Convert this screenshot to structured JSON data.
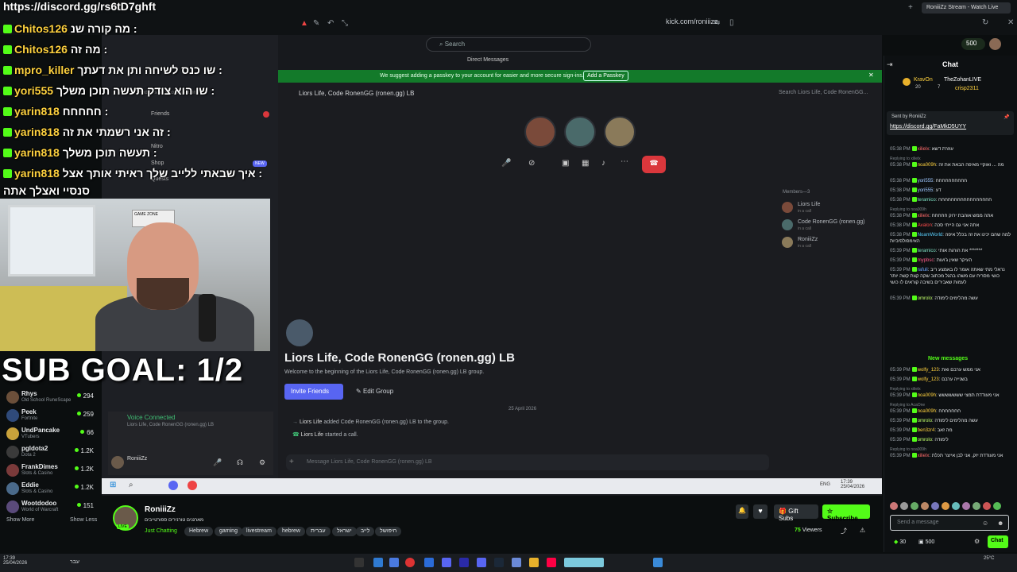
{
  "overlay": {
    "url": "https://discord.gg/rs6tD7ghft",
    "sub_goal": "SUB GOAL: 1/2",
    "lines": [
      {
        "user": "Chitos126",
        "msg": "מה קורה שנ :"
      },
      {
        "user": "Chitos126",
        "msg": "מה זה :"
      },
      {
        "user": "mpro_killer",
        "msg": "שו כנס לשיחה ותן את דעתך :"
      },
      {
        "user": "yori555",
        "msg": "שו הוא צודק תעשה תוכן משלך :"
      },
      {
        "user": "yarin818",
        "msg": "חחחחח :"
      },
      {
        "user": "yarin818",
        "msg": "זה אני רשמתי את זה :"
      },
      {
        "user": "yarin818",
        "msg": "תעשה תוכן משלך :"
      },
      {
        "user": "yarin818",
        "msg": "איך שבאתי ללייב שלך ראיתי אותך אצל :"
      },
      {
        "user": "",
        "msg": "סנסיי ואצלך אתה"
      }
    ]
  },
  "browser": {
    "address": "kick.com/roniiizz",
    "tab_title": "RoniiiZz Stream - Watch Live",
    "search_placeholder": "Search",
    "points": "500"
  },
  "discord": {
    "window_title": "Direct Messages",
    "passkey_banner": "We suggest adding a passkey to your account for easier and more secure sign-ins.",
    "passkey_button": "Add a Passkey",
    "group_header": "Liors Life, Code RonenGG (ronen.gg) LB",
    "group_search": "Search Liors Life, Code RonenGG...",
    "members_label": "Members—3",
    "members": [
      {
        "name": "Liors Life",
        "sub": "in a call"
      },
      {
        "name": "Code RonenGG (ronen.gg)",
        "sub": "in a call"
      },
      {
        "name": "RoniiiZz",
        "sub": "in a call"
      }
    ],
    "sidebar": {
      "conversation": "Find or start a conversation",
      "friends": "Friends",
      "nitro": "Nitro",
      "shop": "Shop",
      "quests": "Quests",
      "new_badge": "NEW"
    },
    "big_title": "Liors Life, Code RonenGG (ronen.gg) LB",
    "welcome": "Welcome to the beginning of the Liors Life, Code RonenGG (ronen.gg) LB group.",
    "invite_button": "Invite Friends",
    "edit_group": "Edit Group",
    "date": "25 April 2026",
    "sys1_user": "Liors Life",
    "sys1_text": "added Code RonenGG (ronen.gg) LB to the group.",
    "sys2_user": "Liors Life",
    "sys2_text": "started a call.",
    "message_placeholder": "Message Liors Life, Code RonenGG (ronen.gg) LB",
    "voice_connected": "Voice Connected",
    "voice_sub": "Liors Life, Code RonenGG (ronen.gg) LB",
    "user_name": "RoniiiZz",
    "user_status": "roniiizz",
    "taskbar_time": "17:39",
    "taskbar_date": "25/04/2026",
    "taskbar_lang": "ENG"
  },
  "webcam": {
    "gaming_sign": "GAME ZONE"
  },
  "left_sidebar": {
    "channels": [
      {
        "name": "Rhys",
        "cat": "Old School RuneScape",
        "count": "294",
        "color": "#6b4f3a"
      },
      {
        "name": "Peek",
        "cat": "Fortnite",
        "count": "259",
        "color": "#2f4a7a"
      },
      {
        "name": "UndPancake",
        "cat": "VTubers",
        "count": "66",
        "color": "#c9a23b"
      },
      {
        "name": "pgldota2",
        "cat": "Dota 2",
        "count": "1.2K",
        "color": "#3a3a3a"
      },
      {
        "name": "FrankDimes",
        "cat": "Slots & Casino",
        "count": "1.2K",
        "color": "#7a3a3a"
      },
      {
        "name": "Eddie",
        "cat": "Slots & Casino",
        "count": "1.2K",
        "color": "#4a6a8a"
      },
      {
        "name": "Wootdodoo",
        "cat": "World of Warcraft",
        "count": "151",
        "color": "#5a4a7a"
      }
    ],
    "show_more": "Show More",
    "show_less": "Show Less"
  },
  "streamer": {
    "name": "RoniiiZz",
    "live": "LIVE",
    "title": "מארגנים טורנירים ספורטייבים",
    "category": "Just Chatting",
    "tags": [
      "Hebrew",
      "gaming",
      "livestream",
      "hebrew",
      "עברית",
      "ישראל",
      "לייב",
      "חיפושל"
    ],
    "gift_subs": "Gift Subs",
    "subscribe": "Subscribe",
    "viewers": "75",
    "viewers_label": "Viewers"
  },
  "chat": {
    "title": "Chat",
    "leaders": [
      "KravOn",
      "TheZohanLIVE",
      "crisp2311"
    ],
    "leader_counts": [
      "20",
      "7"
    ],
    "pinned_by": "Sent by RoniiiZz",
    "pinned_link": "https://discord.gg/FaMkD5UYY",
    "new_messages": "New messages",
    "messages": [
      {
        "time": "05:38 PM",
        "user": "xilielx",
        "text": "עוזרת דשא",
        "color": "#ff6b6b",
        "reply": ""
      },
      {
        "time": "05:38 PM",
        "user": "noa009h",
        "text": "מה ... ואוקיי מאיפה הבאת את זה",
        "color": "#ffd23f",
        "reply": "Replying to xilielx"
      },
      {
        "time": "05:38 PM",
        "user": "yori555",
        "text": "חחחחחחחחחח",
        "color": "#9ec7ff",
        "reply": ""
      },
      {
        "time": "05:38 PM",
        "user": "yori555",
        "text": "דע",
        "color": "#9ec7ff",
        "reply": ""
      },
      {
        "time": "05:38 PM",
        "user": "teramico",
        "text": "חחחחחחחחחחחחחחחחח",
        "color": "#7ee0c3",
        "reply": ""
      },
      {
        "time": "05:38 PM",
        "user": "xilielx",
        "text": "אתה ממש אוהבת ירוק חחחחח",
        "color": "#ff6b6b",
        "reply": "Replying to noa009h"
      },
      {
        "time": "05:38 PM",
        "user": "Avalon",
        "text": "אתה אני גם הייתי סכה",
        "color": "#ff4d4d",
        "reply": ""
      },
      {
        "time": "05:38 PM",
        "user": "NoamWorld",
        "text": "למה שהם יכינו את זה בכלל איפה האימפולסיביות",
        "color": "#5ad1ff",
        "reply": ""
      },
      {
        "time": "05:39 PM",
        "user": "teramico",
        "text": "את הורגת אותי *******",
        "color": "#7ee0c3",
        "reply": ""
      },
      {
        "time": "05:39 PM",
        "user": "mypbsc",
        "text": "העיקר שאין ג'ועות",
        "color": "#ff5c8a",
        "reply": ""
      },
      {
        "time": "05:39 PM",
        "user": "rafuli",
        "text": "נראלי מתי שאתה אומר לו באמצע ריב כושי מסריח עם משהו בהגל מכתוב שקה קצת קשה יותר לעמות שאבירים בשיבה קוראים לו כושי",
        "color": "#6fa8ff",
        "reply": ""
      },
      {
        "time": "05:39 PM",
        "user": "omrolo",
        "text": "עשה מהלימים לימודה",
        "color": "#c0ff6b",
        "reply": ""
      },
      {
        "time": "05:39 PM",
        "user": "wolfy_123",
        "text": "אני ממש ערבם ואת",
        "color": "#ffd23f",
        "reply": ""
      },
      {
        "time": "05:39 PM",
        "user": "wolfy_123",
        "text": "בשנייה ערבם",
        "color": "#ffd23f",
        "reply": ""
      },
      {
        "time": "05:39 PM",
        "user": "noa009h",
        "text": "אני מעודדת תמצי ששששששש",
        "color": "#ffd23f",
        "reply": "Replying to xilielx"
      },
      {
        "time": "05:39 PM",
        "user": "noa009h",
        "text": "חחחחחחח",
        "color": "#ffd23f",
        "reply": "Replying to AcaOne"
      },
      {
        "time": "05:39 PM",
        "user": "omrolo",
        "text": "עשה מהלימים לימודה",
        "color": "#c0ff6b",
        "reply": ""
      },
      {
        "time": "05:39 PM",
        "user": "ben3zr4",
        "text": "מה זאב",
        "color": "#ffd23f",
        "reply": ""
      },
      {
        "time": "05:39 PM",
        "user": "omrolo",
        "text": "לימודה",
        "color": "#c0ff6b",
        "reply": ""
      },
      {
        "time": "05:39 PM",
        "user": "xilielx",
        "text": "אני מעודדת יזק, אני לבן אייצר תכלת",
        "color": "#ff6b6b",
        "reply": "Replying to noa009h"
      }
    ],
    "send_placeholder": "Send a message",
    "chat_button": "Chat",
    "points_a": "30",
    "points_b": "500"
  },
  "windows": {
    "time": "17:39",
    "date": "25/04/2026",
    "lang": "עבר",
    "right": "25°C"
  }
}
